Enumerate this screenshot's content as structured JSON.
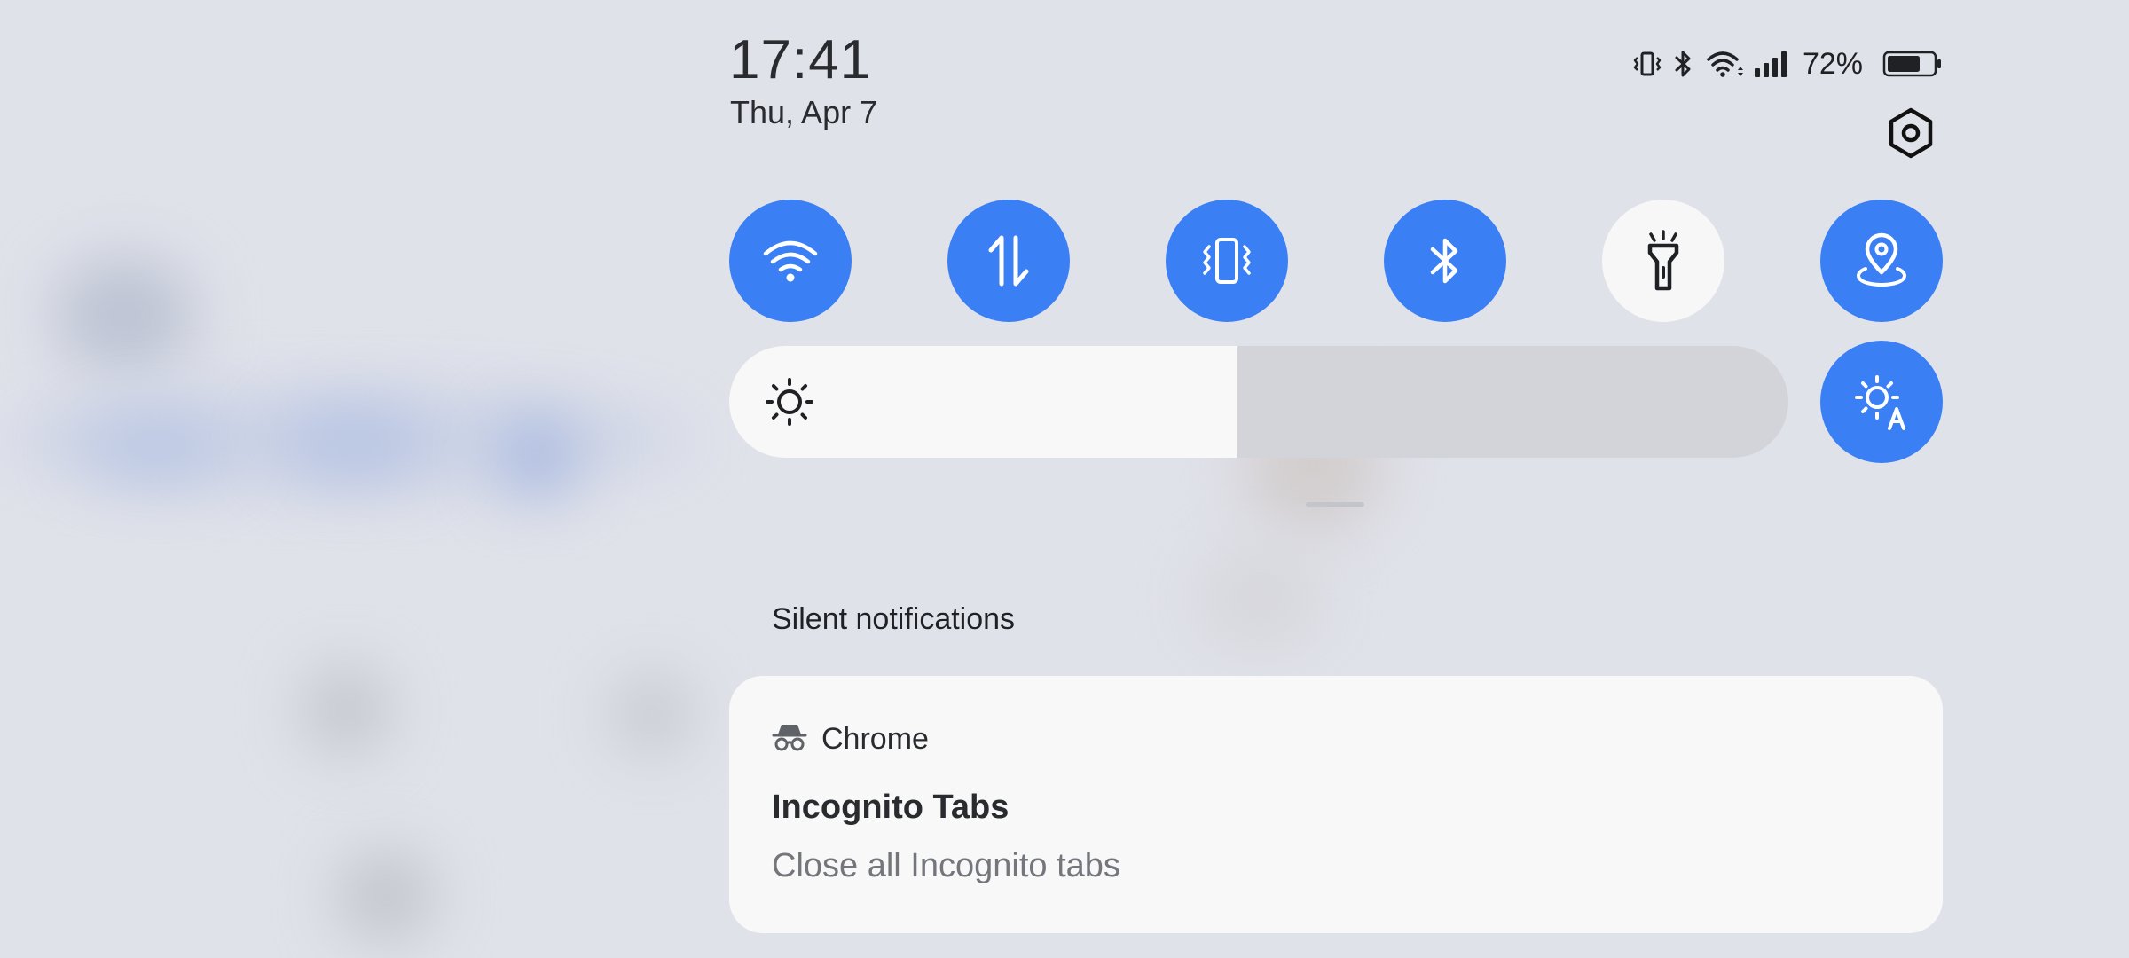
{
  "status": {
    "time": "17:41",
    "date": "Thu, Apr 7",
    "battery_percent": "72%",
    "battery_level": 0.72,
    "indicators": [
      "vibrate-icon",
      "bluetooth-icon",
      "wifi-icon",
      "signal-icon",
      "battery-icon"
    ]
  },
  "quick_settings": {
    "settings_icon": "gear-icon",
    "tiles": [
      {
        "name": "wifi",
        "icon": "wifi-icon",
        "state": "on"
      },
      {
        "name": "mobile-data",
        "icon": "data-arrows-icon",
        "state": "on"
      },
      {
        "name": "vibrate",
        "icon": "vibrate-icon",
        "state": "on"
      },
      {
        "name": "bluetooth",
        "icon": "bluetooth-icon",
        "state": "on"
      },
      {
        "name": "flashlight",
        "icon": "flashlight-icon",
        "state": "off"
      },
      {
        "name": "location",
        "icon": "location-icon",
        "state": "on"
      }
    ],
    "brightness_level": 0.48,
    "auto_brightness": {
      "icon": "auto-brightness-icon",
      "state": "on"
    }
  },
  "colors": {
    "accent": "#3b7ff5",
    "panel_background": "#e0e2ea",
    "card_background": "#f8f8f9"
  },
  "notifications": {
    "section_title": "Silent notifications",
    "items": [
      {
        "app_name": "Chrome",
        "app_icon": "incognito-icon",
        "title": "Incognito Tabs",
        "text": "Close all Incognito tabs"
      }
    ]
  }
}
